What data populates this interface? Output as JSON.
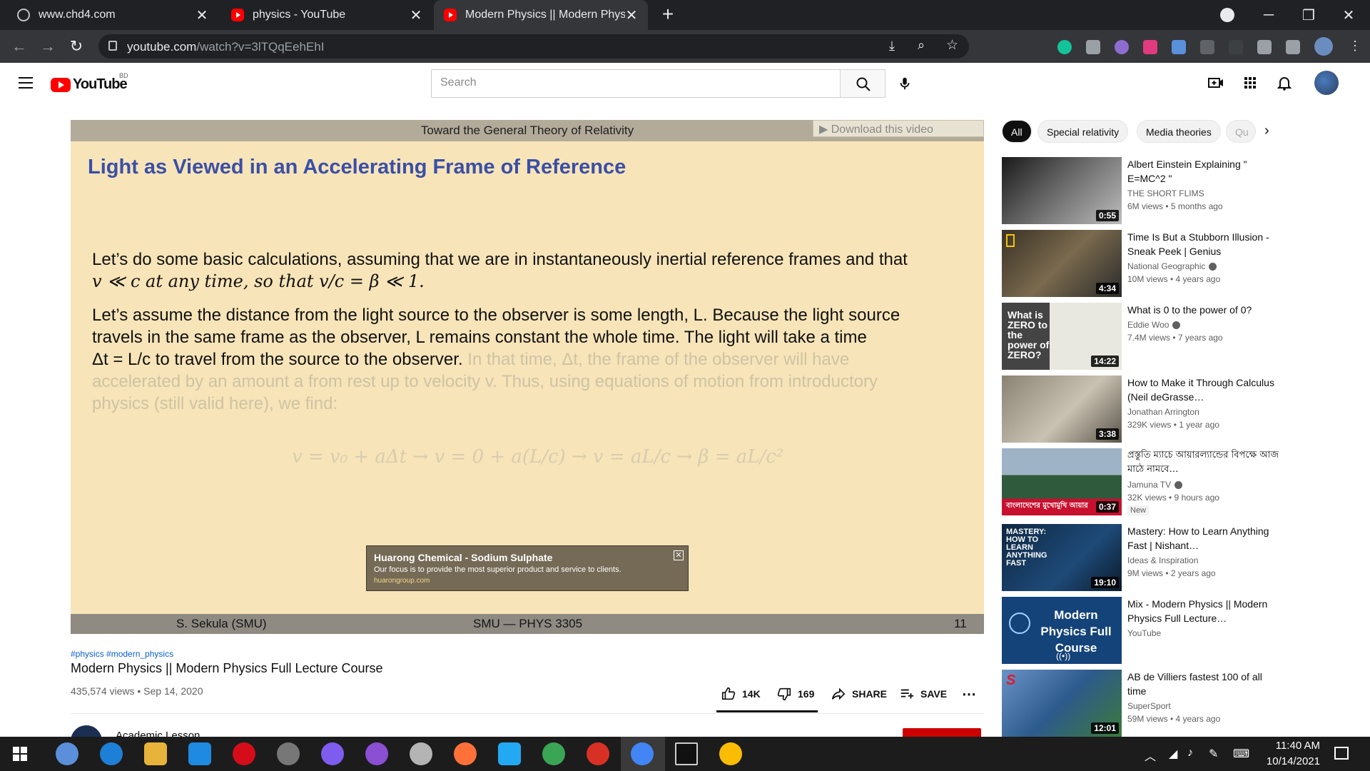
{
  "browser": {
    "tabs": [
      {
        "title": "www.chd4.com",
        "icon": "globe-icon"
      },
      {
        "title": "physics - YouTube",
        "icon": "youtube-icon"
      },
      {
        "title": "Modern Physics || Modern Physic",
        "icon": "youtube-icon",
        "active": true
      }
    ],
    "url_host": "youtube.com",
    "url_path": "/watch?v=3lTQqEehEhI"
  },
  "youtube": {
    "logo_text": "YouTube",
    "country_code": "BD",
    "search_placeholder": "Search"
  },
  "video": {
    "slide": {
      "header": "Toward the General Theory of Relativity",
      "title": "Light as Viewed in an Accelerating Frame of Reference",
      "para1_line1": "Let’s do some basic calculations, assuming that we are in instantaneously inertial reference frames and that",
      "para1_line2": "v ≪ c at any time, so that v/c = β ≪ 1.",
      "para2_line1": "Let’s assume the distance from the light source to the observer is some length, L. Because the light source",
      "para2_line2": "travels in the same frame as the observer, L remains constant the whole time. The light will take a time",
      "para2_line3a": "Δt = L/c to travel from the source to the observer.",
      "para2_line3b": " In that time, Δt, the frame of the observer will have",
      "para2_line4": "accelerated by an amount a from rest up to velocity v. Thus, using equations of motion from introductory",
      "para2_line5": "physics (still valid here), we find:",
      "equation": "v  =  v₀ + aΔt → v = 0 + a(L/c) → v = aL/c → β = aL/c²",
      "footer_author": "S. Sekula  (SMU)",
      "footer_course": "SMU — PHYS 3305",
      "footer_page": "11"
    },
    "download_label": "▶ Download this video",
    "ad": {
      "title": "Huarong Chemical - Sodium Sulphate",
      "text": "Our focus is to provide the most superior product and service to clients.",
      "domain": "huarongroup.com"
    },
    "hashtags": "#physics #modern_physics",
    "title": "Modern Physics || Modern Physics Full Lecture Course",
    "meta": "435,574 views • Sep 14, 2020",
    "likes": "14K",
    "dislikes": "169",
    "share_label": "SHARE",
    "save_label": "SAVE",
    "channel_name": "Academic Lesson"
  },
  "chips": [
    "All",
    "Special relativity",
    "Media theories",
    "Qu"
  ],
  "recommendations": [
    {
      "title": "Albert Einstein Explaining \" E=MC^2 \"",
      "channel": "THE SHORT FLIMS",
      "meta": "6M views • 5 months ago",
      "duration": "0:55",
      "verified": false
    },
    {
      "title": "Time Is But a Stubborn Illusion - Sneak Peek | Genius",
      "channel": "National Geographic",
      "meta": "10M views • 4 years ago",
      "duration": "4:34",
      "verified": true
    },
    {
      "title": "What is 0 to the power of 0?",
      "channel": "Eddie Woo",
      "meta": "7.4M views • 7 years ago",
      "duration": "14:22",
      "verified": true,
      "thumb_text": "What is ZERO to the power of ZERO?"
    },
    {
      "title": "How to Make it Through Calculus (Neil deGrasse…",
      "channel": "Jonathan Arrington",
      "meta": "329K views • 1 year ago",
      "duration": "3:38",
      "verified": false
    },
    {
      "title": "প্রস্তুতি ম্যাচে আয়ারল্যান্ডের বিপক্ষে আজ মাঠে নামবে…",
      "channel": "Jamuna TV",
      "meta": "32K views • 9 hours ago",
      "duration": "0:37",
      "verified": true,
      "badge": "New",
      "thumb_text": "বাংলাদেশের মুখোমুখি আয়ার"
    },
    {
      "title": "Mastery: How to Learn Anything Fast | Nishant…",
      "channel": "Ideas & Inspiration",
      "meta": "9M views • 2 years ago",
      "duration": "19:10",
      "verified": false,
      "thumb_text": "MASTERY: HOW TO LEARN ANYTHING FAST"
    },
    {
      "title": "Mix - Modern Physics || Modern Physics Full Lecture…",
      "channel": "YouTube",
      "meta": "",
      "duration": "",
      "verified": false,
      "thumb_text": "Modern Physics Full Course"
    },
    {
      "title": "AB de Villiers fastest 100 of all time",
      "channel": "SuperSport",
      "meta": "59M views • 4 years ago",
      "duration": "12:01",
      "verified": false
    }
  ],
  "taskbar": {
    "time": "11:40 AM",
    "date": "10/14/2021"
  }
}
